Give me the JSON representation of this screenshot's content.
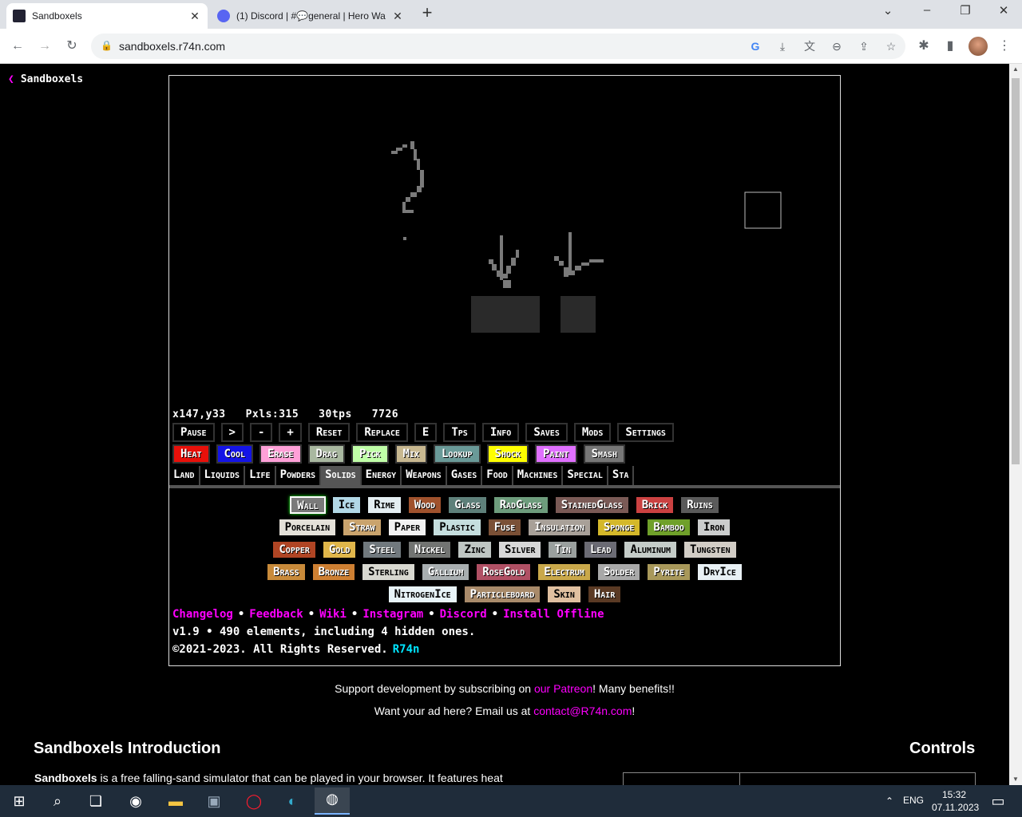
{
  "browser": {
    "tabs": [
      {
        "title": "Sandboxels",
        "active": true
      },
      {
        "title": "(1) Discord | #💬general | Hero Wa",
        "active": false
      }
    ],
    "url": "sandboxels.r74n.com"
  },
  "page": {
    "back_label": "Sandboxels",
    "stats": "x147,y33   Pxls:315   30tps   7726",
    "controls": [
      "Pause",
      ">",
      "-",
      "+",
      "Reset",
      "Replace",
      "E",
      "Tps",
      "Info",
      "Saves",
      "Mods",
      "Settings"
    ],
    "tools": [
      {
        "label": "Heat",
        "bg": "#e8100a"
      },
      {
        "label": "Cool",
        "bg": "#1414e6"
      },
      {
        "label": "Erase",
        "bg": "#ffa0d8"
      },
      {
        "label": "Drag",
        "bg": "#a9b8a0"
      },
      {
        "label": "Pick",
        "bg": "#c0ffa8"
      },
      {
        "label": "Mix",
        "bg": "#c8b890"
      },
      {
        "label": "Lookup",
        "bg": "#6a9a98"
      },
      {
        "label": "Shock",
        "bg": "#ffff00"
      },
      {
        "label": "Paint",
        "bg": "#e070ff"
      },
      {
        "label": "Smash",
        "bg": "#777777"
      }
    ],
    "categories": [
      "Land",
      "Liquids",
      "Life",
      "Powders",
      "Solids",
      "Energy",
      "Weapons",
      "Gases",
      "Food",
      "Machines",
      "Special",
      "Sta"
    ],
    "active_category": "Solids",
    "element_rows": [
      [
        {
          "label": "Wall",
          "bg": "#7a7a7a"
        },
        {
          "label": "Ice",
          "bg": "#b2d8e6"
        },
        {
          "label": "Rime",
          "bg": "#e4eef2"
        },
        {
          "label": "Wood",
          "bg": "#a0522d"
        },
        {
          "label": "Glass",
          "bg": "#5e807a"
        },
        {
          "label": "RadGlass",
          "bg": "#6d9c7c"
        },
        {
          "label": "StainedGlass",
          "bg": "#7a5a56"
        },
        {
          "label": "Brick",
          "bg": "#cb4141"
        },
        {
          "label": "Ruins",
          "bg": "#5a5a5a"
        }
      ],
      [
        {
          "label": "Porcelain",
          "bg": "#e4e1d9"
        },
        {
          "label": "Straw",
          "bg": "#c9a36d"
        },
        {
          "label": "Paper",
          "bg": "#f2f2f2"
        },
        {
          "label": "Plastic",
          "bg": "#c5dede"
        },
        {
          "label": "Fuse",
          "bg": "#7a5036"
        },
        {
          "label": "Insulation",
          "bg": "#a8a098"
        },
        {
          "label": "Sponge",
          "bg": "#d4b82a"
        },
        {
          "label": "Bamboo",
          "bg": "#6fa02a"
        },
        {
          "label": "Iron",
          "bg": "#cbcdcd"
        }
      ],
      [
        {
          "label": "Copper",
          "bg": "#b04524"
        },
        {
          "label": "Gold",
          "bg": "#e0b64a"
        },
        {
          "label": "Steel",
          "bg": "#71797e"
        },
        {
          "label": "Nickel",
          "bg": "#727472"
        },
        {
          "label": "Zinc",
          "bg": "#bfc6c3"
        },
        {
          "label": "Silver",
          "bg": "#d8d8d8"
        },
        {
          "label": "Tin",
          "bg": "#9aa09e"
        },
        {
          "label": "Lead",
          "bg": "#6b6b74"
        },
        {
          "label": "Aluminum",
          "bg": "#c4ccc8"
        },
        {
          "label": "Tungsten",
          "bg": "#d2cdc6"
        }
      ],
      [
        {
          "label": "Brass",
          "bg": "#c88a3a"
        },
        {
          "label": "Bronze",
          "bg": "#cd7f32"
        },
        {
          "label": "Sterling",
          "bg": "#d8d8d0"
        },
        {
          "label": "Gallium",
          "bg": "#a8aeb0"
        },
        {
          "label": "RoseGold",
          "bg": "#b05064"
        },
        {
          "label": "Electrum",
          "bg": "#c9a84a"
        },
        {
          "label": "Solder",
          "bg": "#a8a8a8"
        },
        {
          "label": "Pyrite",
          "bg": "#a8985a"
        },
        {
          "label": "DryIce",
          "bg": "#e8f0f4"
        }
      ],
      [
        {
          "label": "NitrogenIce",
          "bg": "#e8f4f8"
        },
        {
          "label": "Particleboard",
          "bg": "#a88a6a"
        },
        {
          "label": "Skin",
          "bg": "#e0c0a0"
        },
        {
          "label": "Hair",
          "bg": "#5a3a24"
        }
      ]
    ],
    "links": [
      "Changelog",
      "Feedback",
      "Wiki",
      "Instagram",
      "Discord",
      "Install Offline"
    ],
    "version": "v1.9 • 490 elements, including 4 hidden ones.",
    "copyright": "©2021-2023. All Rights Reserved.",
    "author": "R74n",
    "support_prefix": "Support development by subscribing on ",
    "support_link": "our Patreon",
    "support_suffix": "! Many benefits!!",
    "ad_prefix": "Want your ad here? Email us at ",
    "ad_link": "contact@R74n.com",
    "ad_suffix": "!",
    "intro_title": "Sandboxels Introduction",
    "controls_title": "Controls",
    "intro_bold": "Sandboxels",
    "intro_text": " is a free falling-sand simulator that can be played in your browser. It features heat"
  },
  "taskbar": {
    "lang": "ENG",
    "time": "15:32",
    "date": "07.11.2023"
  }
}
